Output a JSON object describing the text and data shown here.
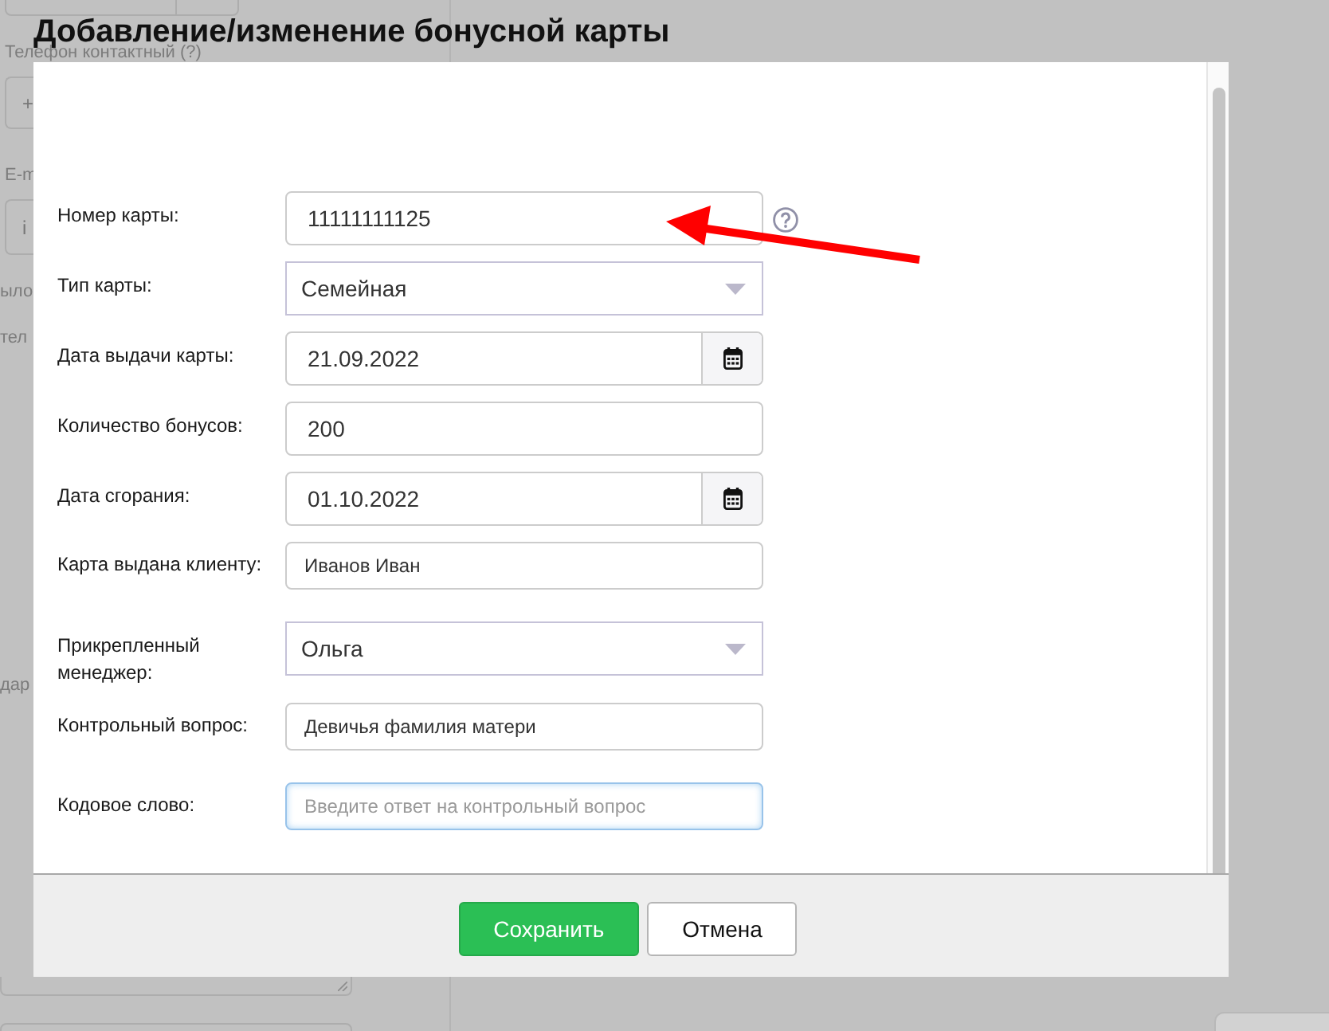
{
  "background_page": {
    "items": [
      {
        "kind": "combo"
      },
      {
        "kind": "label",
        "text": "Телефон контактный (?)"
      },
      {
        "kind": "field",
        "placeholder": "+"
      },
      {
        "kind": "label",
        "text": "E-m"
      },
      {
        "kind": "field",
        "placeholder": "i"
      },
      {
        "kind": "label",
        "text": "ыло"
      },
      {
        "kind": "label",
        "text": "тел"
      },
      {
        "kind": "label",
        "text": "дар"
      },
      {
        "kind": "textarea"
      },
      {
        "kind": "field"
      }
    ]
  },
  "dialog": {
    "title": "Добавление/изменение бонусной карты",
    "fields": [
      {
        "kind": "text",
        "label": "Номер карты:",
        "value": "11111111125",
        "help": true,
        "focused": false
      },
      {
        "kind": "select",
        "label": "Тип карты:",
        "value": "Семейная",
        "focused": false
      },
      {
        "kind": "date",
        "label": "Дата выдачи карты:",
        "value": "21.09.2022",
        "focused": false
      },
      {
        "kind": "text",
        "label": "Количество бонусов:",
        "value": "200",
        "focused": false
      },
      {
        "kind": "date",
        "label": "Дата сгорания:",
        "value": "01.10.2022",
        "focused": false
      },
      {
        "kind": "small",
        "label": "Карта выдана клиенту:",
        "value": "Иванов Иван",
        "focused": false
      },
      {
        "kind": "select",
        "label": "Прикрепленный менеджер:",
        "value": "Ольга",
        "focused": false
      },
      {
        "kind": "small",
        "label": "Контрольный вопрос:",
        "value": "Девичья фамилия матери",
        "focused": false
      },
      {
        "kind": "small",
        "label": "Кодовое слово:",
        "placeholder": "Введите ответ на контрольный вопрос",
        "focused": true
      }
    ],
    "buttons": [
      {
        "kind": "primary",
        "label": "Сохранить"
      },
      {
        "kind": "secondary",
        "label": "Отмена"
      }
    ]
  },
  "annotations": [
    {
      "kind": "arrow"
    }
  ]
}
